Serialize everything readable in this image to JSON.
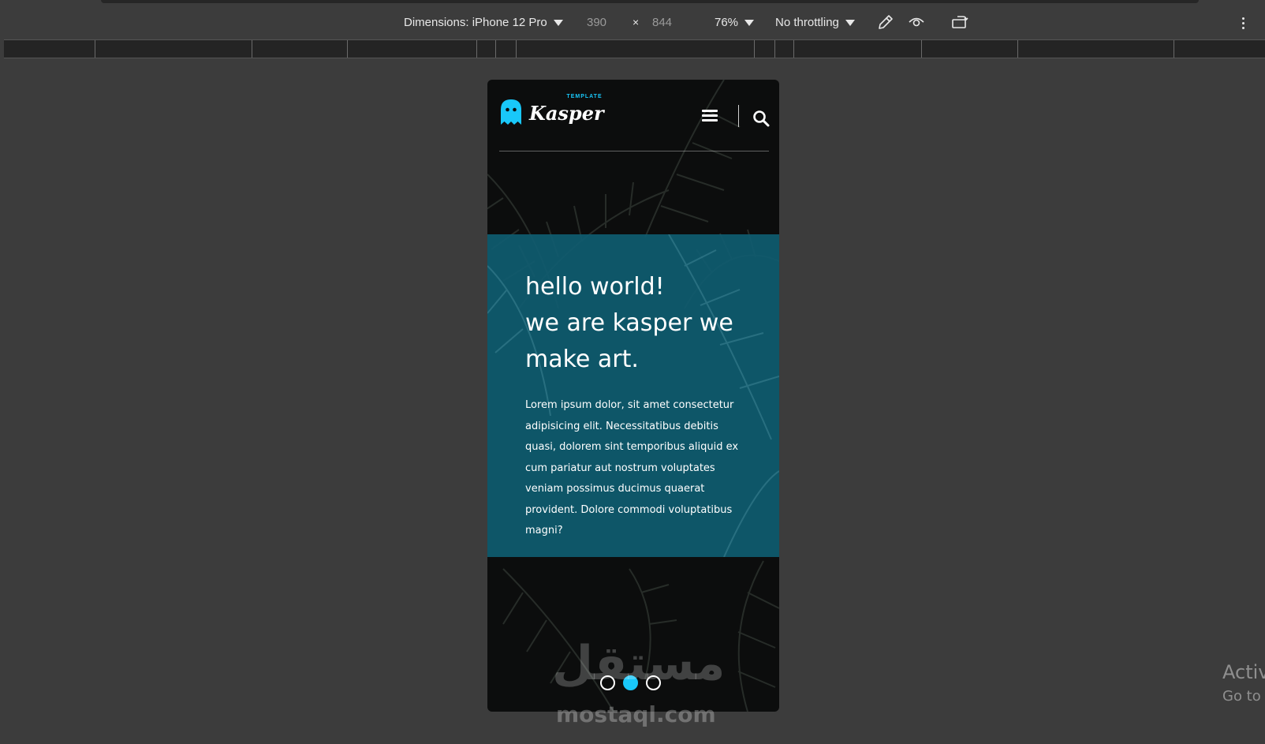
{
  "devtools": {
    "dimensions_label": "Dimensions: iPhone 12 Pro",
    "width": "390",
    "times": "×",
    "height": "844",
    "zoom": "76%",
    "throttling": "No throttling",
    "icons": [
      "dropdown-icon",
      "eyedropper-icon",
      "eye-icon",
      "rotate-device-icon",
      "more-options-icon"
    ]
  },
  "site": {
    "logo_sub": "TEMPLATE",
    "logo_main": "Kasper",
    "headline_lines": [
      "hello world!",
      "we are kasper we",
      "make art."
    ],
    "paragraph": "Lorem ipsum dolor, sit amet consectetur adipisicing elit. Necessitatibus debitis quasi, dolorem sint temporibus aliquid ex cum pariatur aut nostrum voluptates veniam possimus ducimus quaerat provident. Dolore commodi voluptatibus magni?",
    "bullets": [
      {
        "active": false
      },
      {
        "active": true
      },
      {
        "active": false
      }
    ],
    "colors": {
      "accent": "#19c8fa",
      "panel": "#0f5c70",
      "background": "#0c0d0d"
    }
  },
  "watermark": {
    "arabic": "مستقل",
    "latin": "mostaql.com"
  },
  "os_overlay": {
    "line1": "Activ",
    "line2": "Go to"
  }
}
